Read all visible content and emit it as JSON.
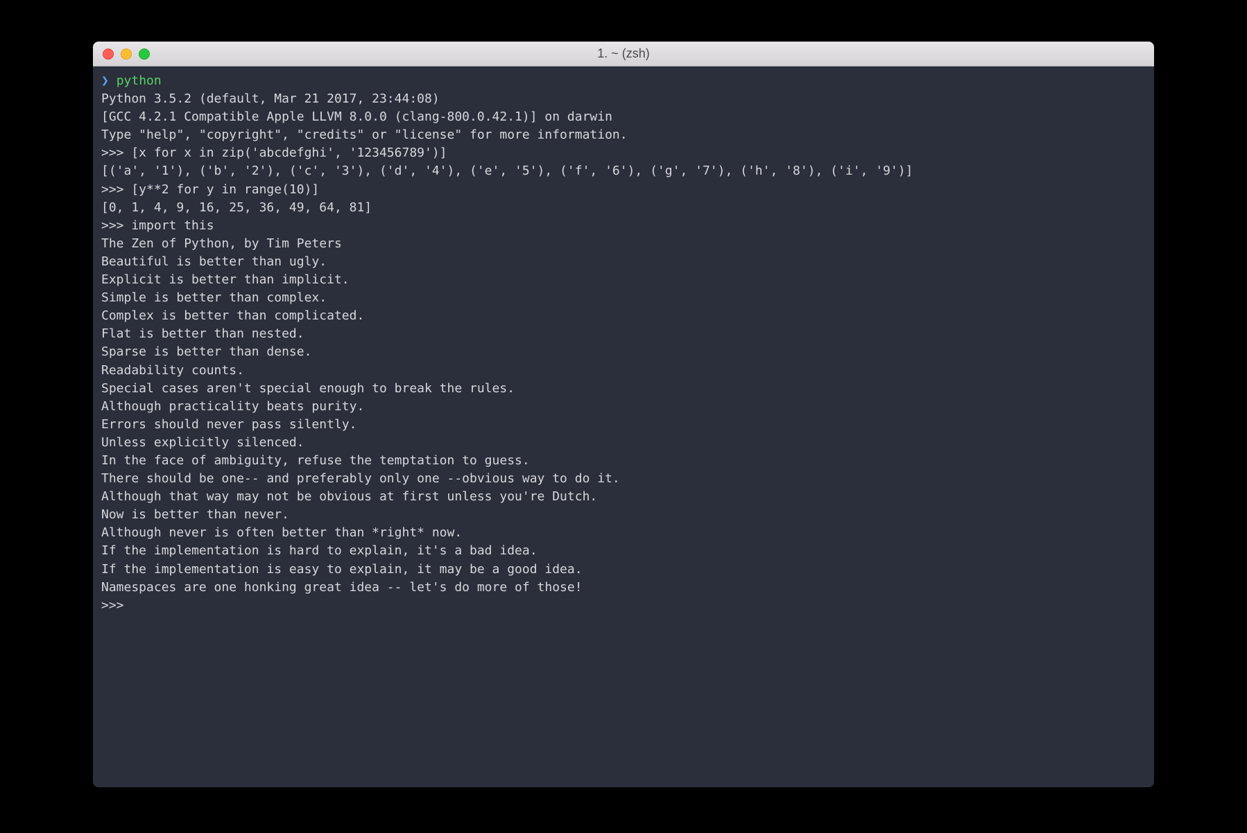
{
  "window": {
    "title": "1. ~ (zsh)"
  },
  "prompt": {
    "arrow": "❯",
    "command": "python"
  },
  "lines": {
    "banner1": "Python 3.5.2 (default, Mar 21 2017, 23:44:08)",
    "banner2": "[GCC 4.2.1 Compatible Apple LLVM 8.0.0 (clang-800.0.42.1)] on darwin",
    "banner3": "Type \"help\", \"copyright\", \"credits\" or \"license\" for more information.",
    "blank": "",
    "in1": ">>> [x for x in zip('abcdefghi', '123456789')]",
    "out1": "[('a', '1'), ('b', '2'), ('c', '3'), ('d', '4'), ('e', '5'), ('f', '6'), ('g', '7'), ('h', '8'), ('i', '9')]",
    "in2": ">>> [y**2 for y in range(10)]",
    "out2": "[0, 1, 4, 9, 16, 25, 36, 49, 64, 81]",
    "in3": ">>> import this",
    "zen_title": "The Zen of Python, by Tim Peters",
    "zen1": "Beautiful is better than ugly.",
    "zen2": "Explicit is better than implicit.",
    "zen3": "Simple is better than complex.",
    "zen4": "Complex is better than complicated.",
    "zen5": "Flat is better than nested.",
    "zen6": "Sparse is better than dense.",
    "zen7": "Readability counts.",
    "zen8": "Special cases aren't special enough to break the rules.",
    "zen9": "Although practicality beats purity.",
    "zen10": "Errors should never pass silently.",
    "zen11": "Unless explicitly silenced.",
    "zen12": "In the face of ambiguity, refuse the temptation to guess.",
    "zen13": "There should be one-- and preferably only one --obvious way to do it.",
    "zen14": "Although that way may not be obvious at first unless you're Dutch.",
    "zen15": "Now is better than never.",
    "zen16": "Although never is often better than *right* now.",
    "zen17": "If the implementation is hard to explain, it's a bad idea.",
    "zen18": "If the implementation is easy to explain, it may be a good idea.",
    "zen19": "Namespaces are one honking great idea -- let's do more of those!",
    "final_prompt": ">>>"
  }
}
